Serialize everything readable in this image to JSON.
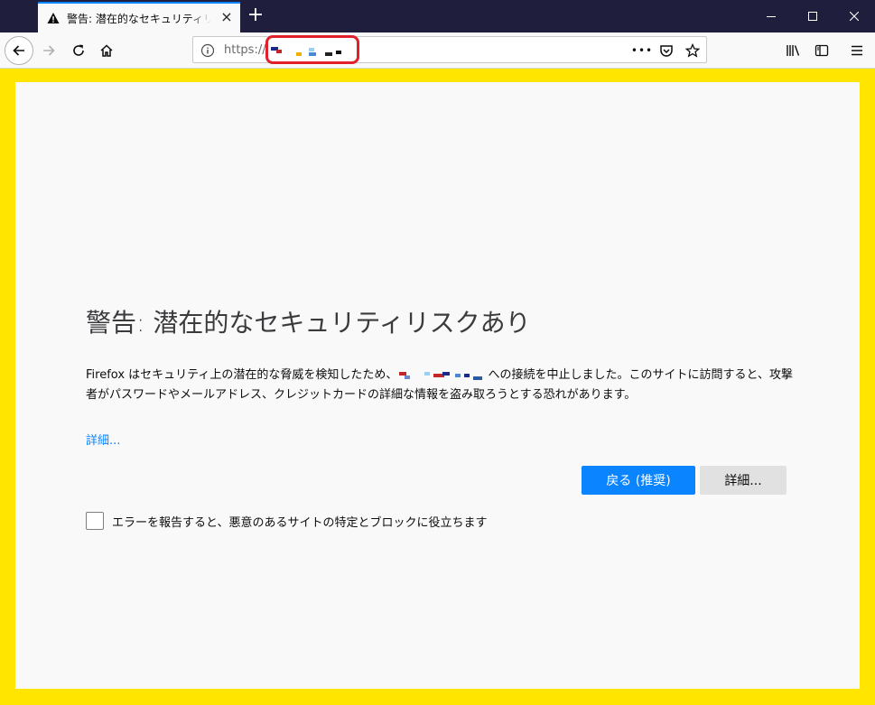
{
  "tab": {
    "title": "警告: 潜在的なセキュリティリスクあり",
    "close": "×",
    "new_tab": "+"
  },
  "window": {
    "minimize_icon": "minimize-icon",
    "maximize_icon": "maximize-icon",
    "close_icon": "close-icon"
  },
  "toolbar": {
    "url_scheme": "https://",
    "page_actions": "•••"
  },
  "page": {
    "heading": "警告: 潜在的なセキュリティリスクあり",
    "description_before": "Firefox はセキュリティ上の潜在的な脅威を検知したため、",
    "description_after": " への接続を中止しました。このサイトに訪問すると、攻撃者がパスワードやメールアドレス、クレジットカードの詳細な情報を盗み取ろうとする恐れがあります。",
    "learn_more": "詳細...",
    "go_back_button": "戻る (推奨)",
    "advanced_button": "詳細...",
    "report_label": "エラーを報告すると、悪意のあるサイトの特定とブロックに役立ちます",
    "report_checked": false
  },
  "colors": {
    "highlight_frame": "#ffe500",
    "primary_button": "#0a84ff",
    "annotation": "#e0202a"
  }
}
